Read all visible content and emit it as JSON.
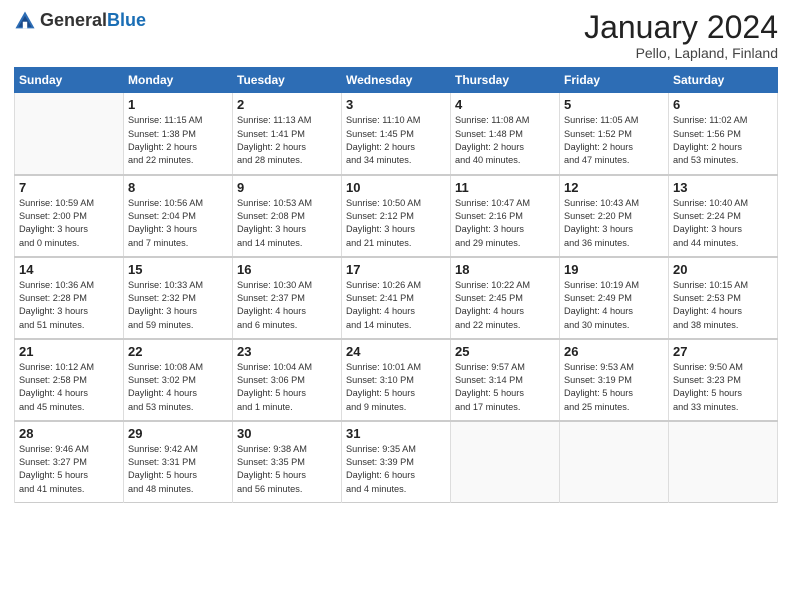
{
  "header": {
    "logo_general": "General",
    "logo_blue": "Blue",
    "month_title": "January 2024",
    "location": "Pello, Lapland, Finland"
  },
  "weekdays": [
    "Sunday",
    "Monday",
    "Tuesday",
    "Wednesday",
    "Thursday",
    "Friday",
    "Saturday"
  ],
  "weeks": [
    [
      {
        "day": "",
        "info": ""
      },
      {
        "day": "1",
        "info": "Sunrise: 11:15 AM\nSunset: 1:38 PM\nDaylight: 2 hours\nand 22 minutes."
      },
      {
        "day": "2",
        "info": "Sunrise: 11:13 AM\nSunset: 1:41 PM\nDaylight: 2 hours\nand 28 minutes."
      },
      {
        "day": "3",
        "info": "Sunrise: 11:10 AM\nSunset: 1:45 PM\nDaylight: 2 hours\nand 34 minutes."
      },
      {
        "day": "4",
        "info": "Sunrise: 11:08 AM\nSunset: 1:48 PM\nDaylight: 2 hours\nand 40 minutes."
      },
      {
        "day": "5",
        "info": "Sunrise: 11:05 AM\nSunset: 1:52 PM\nDaylight: 2 hours\nand 47 minutes."
      },
      {
        "day": "6",
        "info": "Sunrise: 11:02 AM\nSunset: 1:56 PM\nDaylight: 2 hours\nand 53 minutes."
      }
    ],
    [
      {
        "day": "7",
        "info": "Sunrise: 10:59 AM\nSunset: 2:00 PM\nDaylight: 3 hours\nand 0 minutes."
      },
      {
        "day": "8",
        "info": "Sunrise: 10:56 AM\nSunset: 2:04 PM\nDaylight: 3 hours\nand 7 minutes."
      },
      {
        "day": "9",
        "info": "Sunrise: 10:53 AM\nSunset: 2:08 PM\nDaylight: 3 hours\nand 14 minutes."
      },
      {
        "day": "10",
        "info": "Sunrise: 10:50 AM\nSunset: 2:12 PM\nDaylight: 3 hours\nand 21 minutes."
      },
      {
        "day": "11",
        "info": "Sunrise: 10:47 AM\nSunset: 2:16 PM\nDaylight: 3 hours\nand 29 minutes."
      },
      {
        "day": "12",
        "info": "Sunrise: 10:43 AM\nSunset: 2:20 PM\nDaylight: 3 hours\nand 36 minutes."
      },
      {
        "day": "13",
        "info": "Sunrise: 10:40 AM\nSunset: 2:24 PM\nDaylight: 3 hours\nand 44 minutes."
      }
    ],
    [
      {
        "day": "14",
        "info": "Sunrise: 10:36 AM\nSunset: 2:28 PM\nDaylight: 3 hours\nand 51 minutes."
      },
      {
        "day": "15",
        "info": "Sunrise: 10:33 AM\nSunset: 2:32 PM\nDaylight: 3 hours\nand 59 minutes."
      },
      {
        "day": "16",
        "info": "Sunrise: 10:30 AM\nSunset: 2:37 PM\nDaylight: 4 hours\nand 6 minutes."
      },
      {
        "day": "17",
        "info": "Sunrise: 10:26 AM\nSunset: 2:41 PM\nDaylight: 4 hours\nand 14 minutes."
      },
      {
        "day": "18",
        "info": "Sunrise: 10:22 AM\nSunset: 2:45 PM\nDaylight: 4 hours\nand 22 minutes."
      },
      {
        "day": "19",
        "info": "Sunrise: 10:19 AM\nSunset: 2:49 PM\nDaylight: 4 hours\nand 30 minutes."
      },
      {
        "day": "20",
        "info": "Sunrise: 10:15 AM\nSunset: 2:53 PM\nDaylight: 4 hours\nand 38 minutes."
      }
    ],
    [
      {
        "day": "21",
        "info": "Sunrise: 10:12 AM\nSunset: 2:58 PM\nDaylight: 4 hours\nand 45 minutes."
      },
      {
        "day": "22",
        "info": "Sunrise: 10:08 AM\nSunset: 3:02 PM\nDaylight: 4 hours\nand 53 minutes."
      },
      {
        "day": "23",
        "info": "Sunrise: 10:04 AM\nSunset: 3:06 PM\nDaylight: 5 hours\nand 1 minute."
      },
      {
        "day": "24",
        "info": "Sunrise: 10:01 AM\nSunset: 3:10 PM\nDaylight: 5 hours\nand 9 minutes."
      },
      {
        "day": "25",
        "info": "Sunrise: 9:57 AM\nSunset: 3:14 PM\nDaylight: 5 hours\nand 17 minutes."
      },
      {
        "day": "26",
        "info": "Sunrise: 9:53 AM\nSunset: 3:19 PM\nDaylight: 5 hours\nand 25 minutes."
      },
      {
        "day": "27",
        "info": "Sunrise: 9:50 AM\nSunset: 3:23 PM\nDaylight: 5 hours\nand 33 minutes."
      }
    ],
    [
      {
        "day": "28",
        "info": "Sunrise: 9:46 AM\nSunset: 3:27 PM\nDaylight: 5 hours\nand 41 minutes."
      },
      {
        "day": "29",
        "info": "Sunrise: 9:42 AM\nSunset: 3:31 PM\nDaylight: 5 hours\nand 48 minutes."
      },
      {
        "day": "30",
        "info": "Sunrise: 9:38 AM\nSunset: 3:35 PM\nDaylight: 5 hours\nand 56 minutes."
      },
      {
        "day": "31",
        "info": "Sunrise: 9:35 AM\nSunset: 3:39 PM\nDaylight: 6 hours\nand 4 minutes."
      },
      {
        "day": "",
        "info": ""
      },
      {
        "day": "",
        "info": ""
      },
      {
        "day": "",
        "info": ""
      }
    ]
  ]
}
